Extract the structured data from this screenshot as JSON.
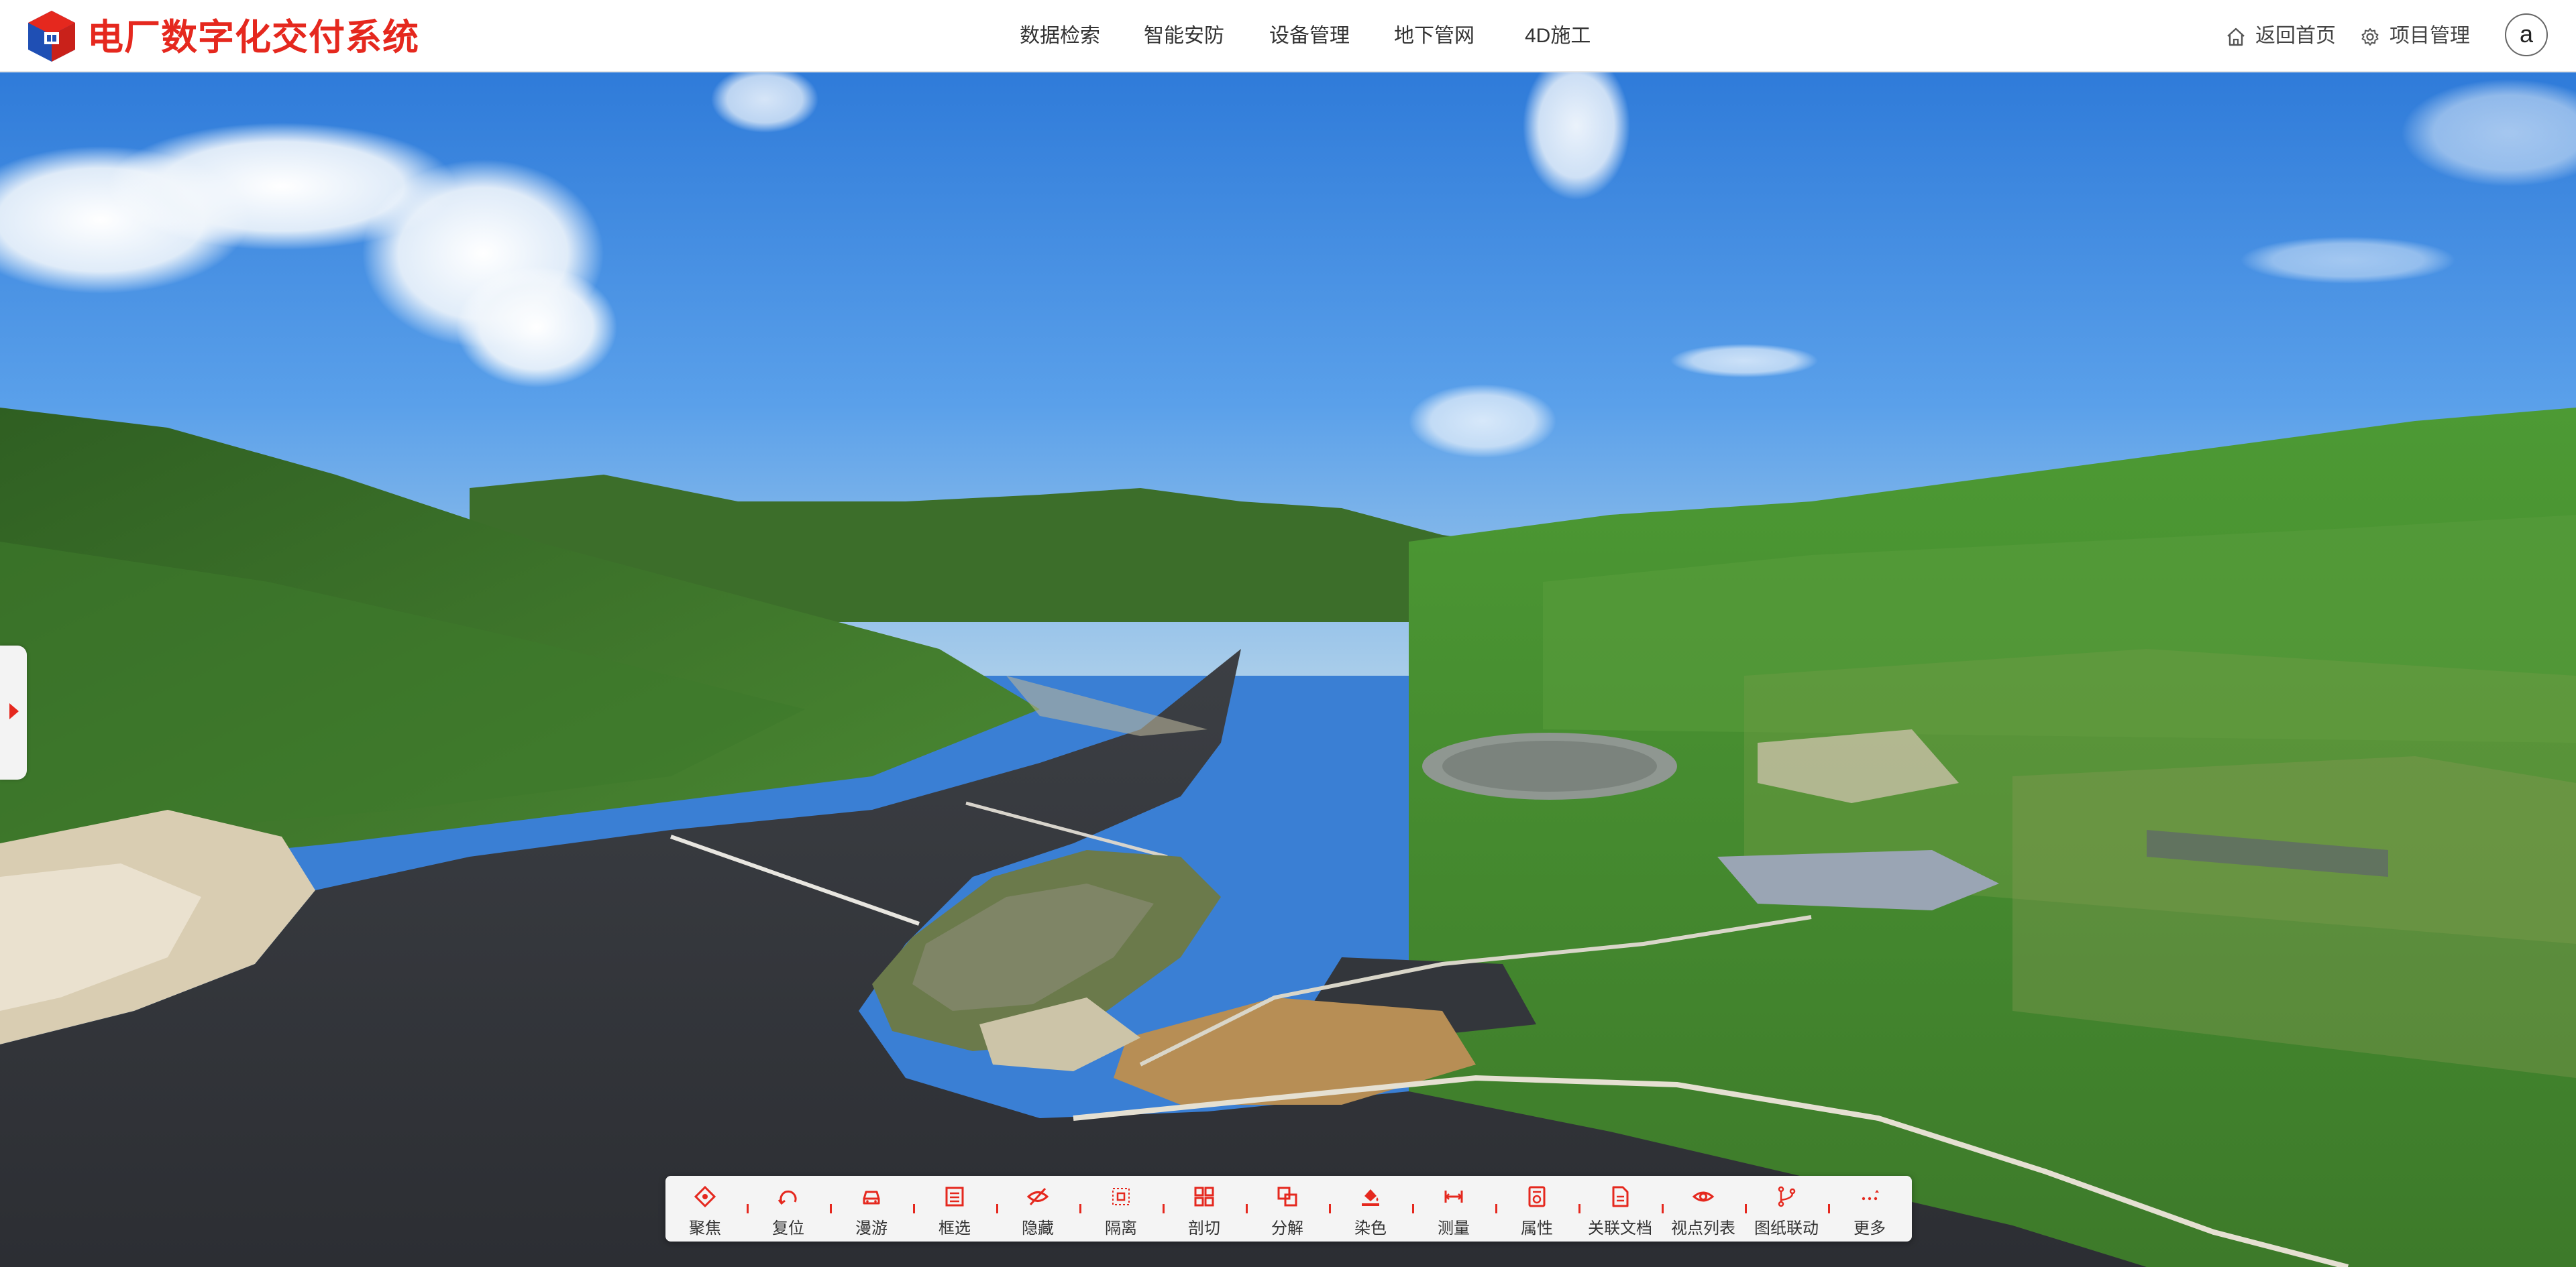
{
  "app": {
    "title": "电厂数字化交付系统",
    "brand_color": "#e5281e"
  },
  "nav": {
    "items": [
      {
        "label": "数据检索"
      },
      {
        "label": "智能安防"
      },
      {
        "label": "设备管理"
      },
      {
        "label": "地下管网"
      },
      {
        "label": "4D施工"
      }
    ]
  },
  "header_tools": {
    "home_label": "返回首页",
    "home_icon": "home-icon",
    "project_label": "项目管理",
    "project_icon": "gear-icon",
    "avatar_letter": "a"
  },
  "toolbar": {
    "items": [
      {
        "label": "聚焦",
        "icon": "focus-icon"
      },
      {
        "label": "复位",
        "icon": "reset-icon"
      },
      {
        "label": "漫游",
        "icon": "car-icon"
      },
      {
        "label": "框选",
        "icon": "box-select-icon"
      },
      {
        "label": "隐藏",
        "icon": "eye-off-icon"
      },
      {
        "label": "隔离",
        "icon": "isolate-icon"
      },
      {
        "label": "剖切",
        "icon": "section-icon"
      },
      {
        "label": "分解",
        "icon": "explode-icon"
      },
      {
        "label": "染色",
        "icon": "paint-icon"
      },
      {
        "label": "测量",
        "icon": "measure-icon"
      },
      {
        "label": "属性",
        "icon": "properties-icon"
      },
      {
        "label": "关联文档",
        "icon": "document-icon"
      },
      {
        "label": "视点列表",
        "icon": "eye-icon"
      },
      {
        "label": "图纸联动",
        "icon": "drawing-link-icon"
      },
      {
        "label": "更多",
        "icon": "more-icon"
      }
    ],
    "icon_color": "#e5281e"
  }
}
